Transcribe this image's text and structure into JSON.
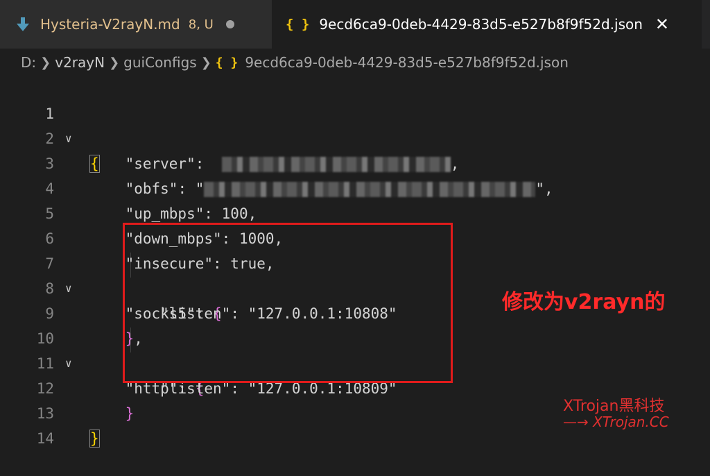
{
  "tabs": [
    {
      "title": "Hysteria-V2rayN.md",
      "badge": "8, U"
    },
    {
      "icon_text": "{ }",
      "title": "9ecd6ca9-0deb-4429-83d5-e527b8f9f52d.json",
      "close": "✕"
    }
  ],
  "breadcrumb": {
    "drive": "D:",
    "folder1": "v2rayN",
    "folder2": "guiConfigs",
    "file_icon": "{ }",
    "file": "9ecd6ca9-0deb-4429-83d5-e527b8f9f52d.json"
  },
  "code": {
    "l1": "{",
    "l2_key": "\"server\"",
    "l2_colon": ":",
    "l2_end": ",",
    "l3_key": "\"obfs\"",
    "l3_colon": ": \"",
    "l3_end": "\",",
    "l4_key": "\"up_mbps\"",
    "l4_val": ": 100,",
    "l5_key": "\"down_mbps\"",
    "l5_val": ": 1000,",
    "l6_key": "\"insecure\"",
    "l6_val": ": true,",
    "l7_key": "\"socks5\"",
    "l7_colon": ": ",
    "l7_brace": "{",
    "l8_key": "\"listen\"",
    "l8_val": ": \"127.0.0.1:10808\"",
    "l9_brace": "}",
    "l9_comma": ",",
    "l10_key": "\"http\"",
    "l10_colon": ": ",
    "l10_brace": "{",
    "l11_key": "\"listen\"",
    "l11_val": ": \"127.0.0.1:10809\"",
    "l12_brace": "}",
    "l13": "}"
  },
  "line_numbers": [
    "1",
    "2",
    "3",
    "4",
    "5",
    "6",
    "7",
    "8",
    "9",
    "10",
    "11",
    "12",
    "13",
    "14"
  ],
  "annotation": "修改为v2rayn的",
  "watermark": {
    "line1": "XTrojan黑科技",
    "line2": "—→ XTrojan.CC"
  },
  "colors": {
    "accent_red": "#e01b1b",
    "brace_yellow": "#ffd700",
    "brace_purple": "#da70d6",
    "modified_orange": "#e2c08d"
  },
  "icons": {
    "tab1": "download-arrow-icon",
    "tab2": "json-braces-icon",
    "close": "close-icon",
    "fold": "chevron-down-icon"
  }
}
